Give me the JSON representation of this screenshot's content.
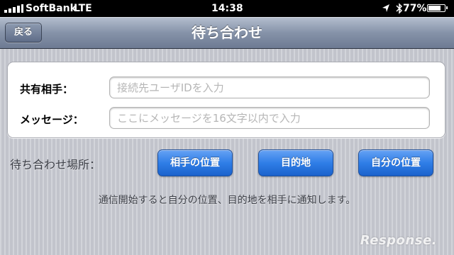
{
  "status_bar": {
    "carrier": "SoftBank",
    "network": "LTE",
    "time": "14:38",
    "battery": "77%",
    "battery_level": 0.77,
    "icons": [
      "signal-icon",
      "location-arrow-icon",
      "bluetooth-icon",
      "battery-icon"
    ]
  },
  "nav": {
    "back_label": "戻る",
    "title": "待ち合わせ"
  },
  "form": {
    "partner_label": "共有相手：",
    "partner_placeholder": "接続先ユーザIDを入力",
    "partner_value": "",
    "message_label": "メッセージ：",
    "message_placeholder": "ここにメッセージを16文字以内で入力",
    "message_value": ""
  },
  "meeting_place": {
    "label": "待ち合わせ場所：",
    "buttons": [
      {
        "label": "相手の位置"
      },
      {
        "label": "目的地"
      },
      {
        "label": "自分の位置"
      }
    ]
  },
  "info_text": "通信開始すると自分の位置、目的地を相手に通知します。",
  "watermark": "Response.",
  "colors": {
    "nav_bar": "#8693a9",
    "button_blue": "#2f7ee7",
    "background": "#c8cad2"
  }
}
